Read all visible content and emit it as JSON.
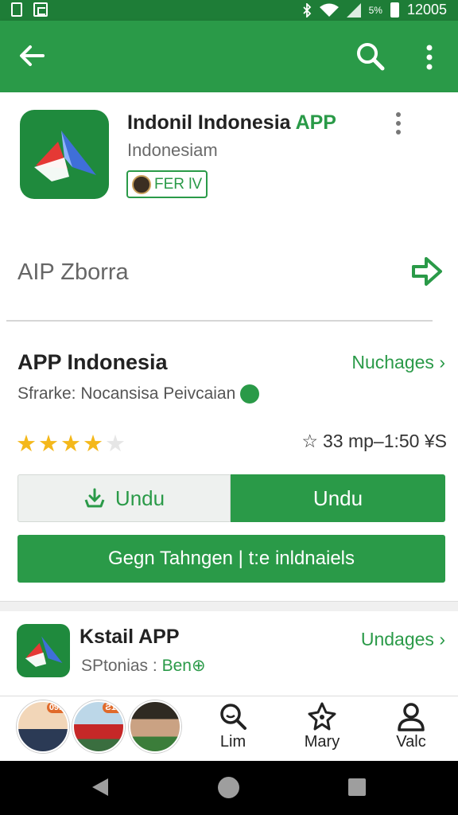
{
  "status_bar": {
    "signal_small": "5%",
    "time": "12005",
    "icons": [
      "sim-icon",
      "gallery-icon",
      "bluetooth-icon",
      "wifi-icon",
      "signal-icon",
      "battery-icon"
    ]
  },
  "app_bar": {
    "icons": [
      "back-arrow-icon",
      "search-icon",
      "more-vert-icon"
    ],
    "color": "#2a9a48"
  },
  "app_header": {
    "title_main": "Indonil Indonesia ",
    "title_accent": "APP",
    "subtitle": "Indonesiam",
    "badge_label": "FER lV"
  },
  "section_label": "AIP Zborra",
  "details": {
    "title": "APP Indonesia",
    "link": "Nuchages",
    "description": "Sfrarke: Nocansisa Peivcaian",
    "rating_stars": 4,
    "rating_max": 5,
    "size": "33 mp–1:50 ¥S"
  },
  "buttons": {
    "left_label": "Undu",
    "right_label": "Undu",
    "wide_label": "Gegn Tahngen | t:e inldnaiels"
  },
  "related_app": {
    "title": "Kstail APP",
    "link": "Undages",
    "sub_prefix": "SPtonias : ",
    "sub_accent": "Ben"
  },
  "bottom_nav": {
    "avatar_badges": [
      "09K",
      "Ƨ15"
    ],
    "items": [
      {
        "label": "Lim",
        "icon": "search-icon"
      },
      {
        "label": "Mary",
        "icon": "diamond-icon"
      },
      {
        "label": "Valc",
        "icon": "person-icon"
      }
    ]
  },
  "colors": {
    "primary": "#2a9a48",
    "status_bar": "#1e7d37",
    "star": "#f4b81b"
  }
}
